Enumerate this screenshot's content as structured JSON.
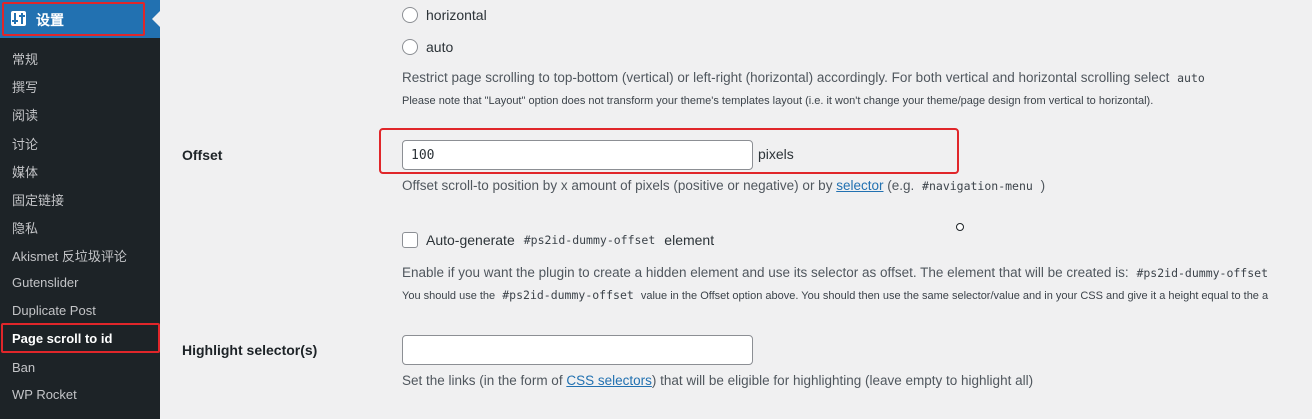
{
  "sidebar": {
    "header": {
      "label": "设置",
      "icon": "settings-sliders-icon"
    },
    "items": [
      {
        "label": "常规"
      },
      {
        "label": "撰写"
      },
      {
        "label": "阅读"
      },
      {
        "label": "讨论"
      },
      {
        "label": "媒体"
      },
      {
        "label": "固定链接"
      },
      {
        "label": "隐私"
      },
      {
        "label": "Akismet 反垃圾评论"
      },
      {
        "label": "Gutenslider"
      },
      {
        "label": "Duplicate Post"
      },
      {
        "label": "Page scroll to id"
      },
      {
        "label": "Ban"
      },
      {
        "label": "WP Rocket"
      }
    ],
    "active_index": 10
  },
  "layout_options": {
    "options": [
      {
        "label": "horizontal"
      },
      {
        "label": "auto"
      }
    ],
    "desc": "Restrict page scrolling to top-bottom (vertical) or left-right (horizontal) accordingly. For both vertical and horizontal scrolling select",
    "desc_code": "auto",
    "note": "Please note that \"Layout\" option does not transform your theme's templates layout (i.e. it won't change your theme/page design from vertical to horizontal)."
  },
  "offset": {
    "label": "Offset",
    "value": "100",
    "unit": "pixels",
    "desc_before": "Offset scroll-to position by x amount of pixels (positive or negative) or by",
    "desc_link": "selector",
    "desc_mid": "(e.g.",
    "desc_code": "#navigation-menu",
    "desc_after": ")"
  },
  "dummy_offset": {
    "check_before": "Auto-generate",
    "check_code": "#ps2id-dummy-offset",
    "check_after": "element",
    "desc": "Enable if you want the plugin to create a hidden element and use its selector as offset. The element that will be created is:",
    "desc_code": "#ps2id-dummy-offset",
    "note_before": "You should use the",
    "note_code": "#ps2id-dummy-offset",
    "note_after": "value in the Offset option above. You should then use the same selector/value and in your CSS and give it a height equal to the a"
  },
  "highlight": {
    "label": "Highlight selector(s)",
    "value": "",
    "desc_before": "Set the links (in the form of",
    "desc_link": "CSS selectors",
    "desc_after": ") that will be eligible for highlighting (leave empty to highlight all)"
  },
  "colors": {
    "sidebar_bg": "#1d2327",
    "active_header": "#2271b1",
    "highlight_border": "#e0262a",
    "link": "#2271b1"
  }
}
